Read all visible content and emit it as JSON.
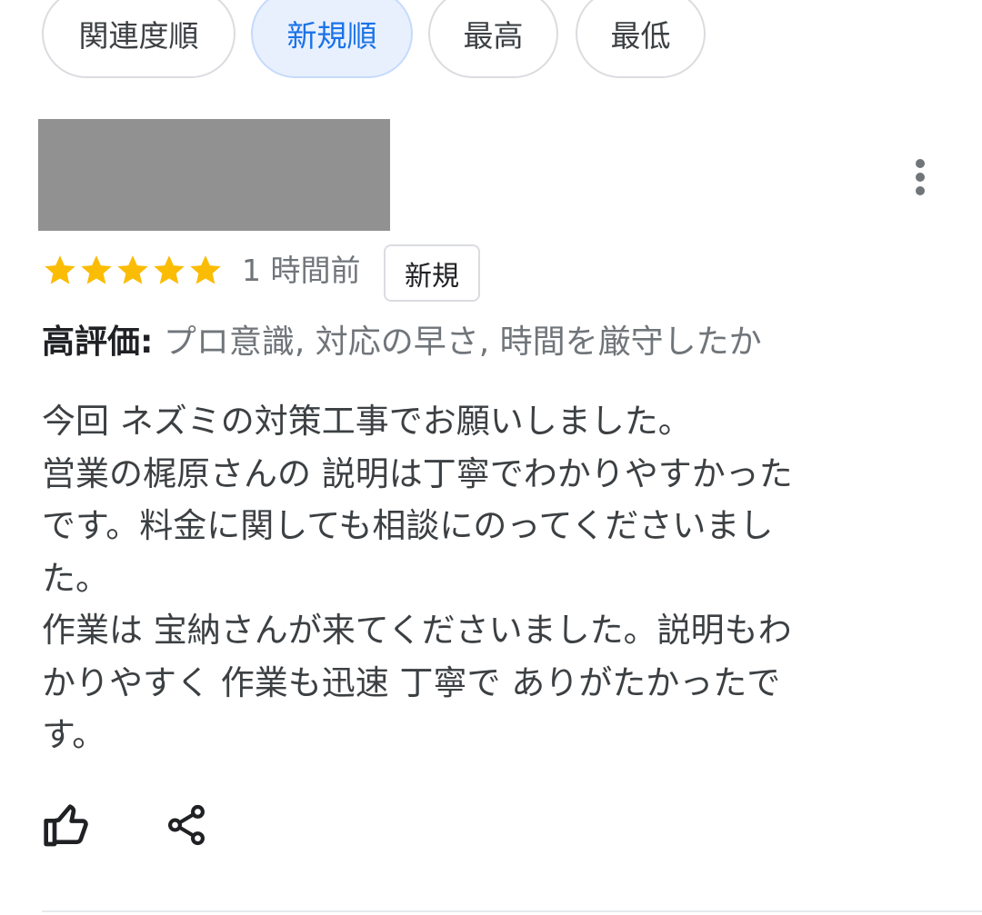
{
  "sort_chips": [
    {
      "label": "関連度順",
      "selected": false
    },
    {
      "label": "新規順",
      "selected": true
    },
    {
      "label": "最高",
      "selected": false
    },
    {
      "label": "最低",
      "selected": false
    }
  ],
  "review": {
    "rating": 5,
    "rating_max": 5,
    "time": "1 時間前",
    "badge": "新規",
    "highlights_label": "高評価:",
    "highlights_value": " プロ意識, 対応の早さ, 時間を厳守したか",
    "text_lines": [
      "今回 ネズミの対策工事でお願いしました。",
      "営業の梶原さんの 説明は丁寧でわかりやすかった",
      "です。料金に関しても相談にのってくださいまし",
      "た。",
      "作業は 宝納さんが来てくださいました。説明もわ",
      "かりやすく 作業も迅速 丁寧で ありがたかったで",
      "す。"
    ]
  },
  "icons": {
    "star": "star-icon",
    "menu": "more-vertical-icon",
    "like": "thumbs-up-icon",
    "share": "share-icon"
  },
  "colors": {
    "star": "#fbbc04",
    "selected_chip_bg": "#e8f0fe",
    "selected_chip_text": "#1a73e8",
    "redaction": "#919191"
  }
}
